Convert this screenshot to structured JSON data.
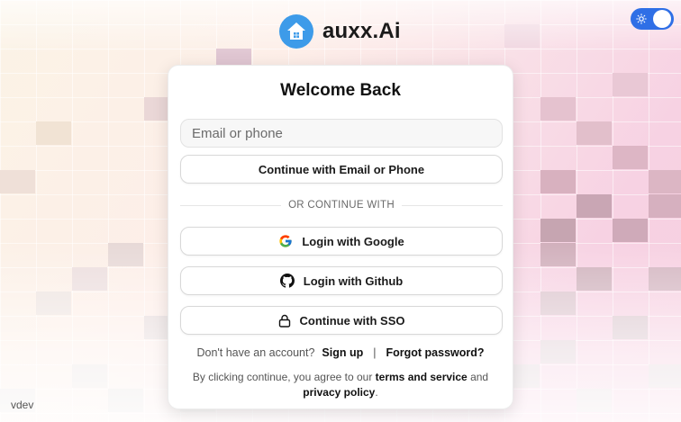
{
  "brand": {
    "name": "auxx.Ai",
    "logo_icon": "home-icon",
    "accent": "#3d9be9"
  },
  "theme_toggle": {
    "icon": "sun-icon",
    "state": "on",
    "color": "#2f6fe6"
  },
  "card": {
    "title": "Welcome Back",
    "email_placeholder": "Email or phone",
    "email_value": "",
    "continue_label": "Continue with Email or Phone",
    "divider_label": "OR CONTINUE WITH",
    "google_label": "Login with Google",
    "github_label": "Login with Github",
    "sso_label": "Continue with SSO",
    "no_account_text": "Don't have an account?",
    "signup_label": "Sign up",
    "separator": "|",
    "forgot_label": "Forgot password?",
    "legal_prefix": "By clicking continue, you agree to our",
    "terms_label": "terms and service",
    "legal_and": "and",
    "privacy_label": "privacy policy",
    "legal_suffix": "."
  },
  "footer": {
    "tag": "vdev"
  }
}
